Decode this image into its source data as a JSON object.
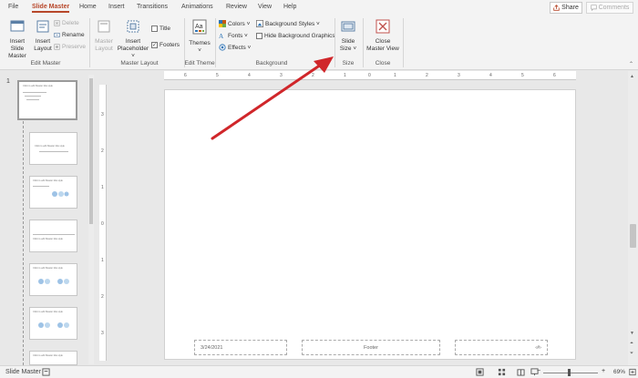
{
  "tabs": [
    "File",
    "Slide Master",
    "Home",
    "Insert",
    "Transitions",
    "Animations",
    "Review",
    "View",
    "Help"
  ],
  "share": {
    "label": "Share"
  },
  "comments": {
    "label": "Comments"
  },
  "ribbon": {
    "edit_master": {
      "label": "Edit Master",
      "insert_slide_master": [
        "Insert Slide",
        "Master"
      ],
      "insert_layout": [
        "Insert",
        "Layout"
      ],
      "delete": "Delete",
      "rename": "Rename",
      "preserve": "Preserve"
    },
    "master_layout": {
      "label": "Master Layout",
      "master_layout_btn": [
        "Master",
        "Layout"
      ],
      "insert_placeholder": [
        "Insert",
        "Placeholder ˅"
      ],
      "title_chk": "Title",
      "footers_chk": "Footers"
    },
    "edit_theme": {
      "label": "Edit Theme",
      "themes": [
        "Themes",
        "˅"
      ]
    },
    "background": {
      "label": "Background",
      "colors": "Colors ˅",
      "fonts": "Fonts ˅",
      "effects": "Effects ˅",
      "background_styles": "Background Styles ˅",
      "hide_bg_graphics": "Hide Background Graphics"
    },
    "size": {
      "label": "Size",
      "slide_size": [
        "Slide",
        "Size ˅"
      ]
    },
    "close": {
      "label": "Close",
      "close_master_view": [
        "Close",
        "Master View"
      ]
    }
  },
  "thumbnails": {
    "first_number": "1",
    "master_title": "Click to edit Master title style",
    "layout_title": "Click to edit Master title style"
  },
  "slide": {
    "date": "3/24/2021",
    "footer": "Footer",
    "page_number": "‹#›"
  },
  "ruler": {
    "h_labels": [
      "6",
      "5",
      "4",
      "3",
      "2",
      "1",
      "0",
      "1",
      "2",
      "3",
      "4",
      "5",
      "6"
    ],
    "v_labels": [
      "3",
      "2",
      "1",
      "0",
      "1",
      "2",
      "3"
    ]
  },
  "status": {
    "view": "Slide Master",
    "zoom": "69%"
  },
  "colors": {
    "accent": "#b7472a",
    "arrow": "#d0262a"
  }
}
